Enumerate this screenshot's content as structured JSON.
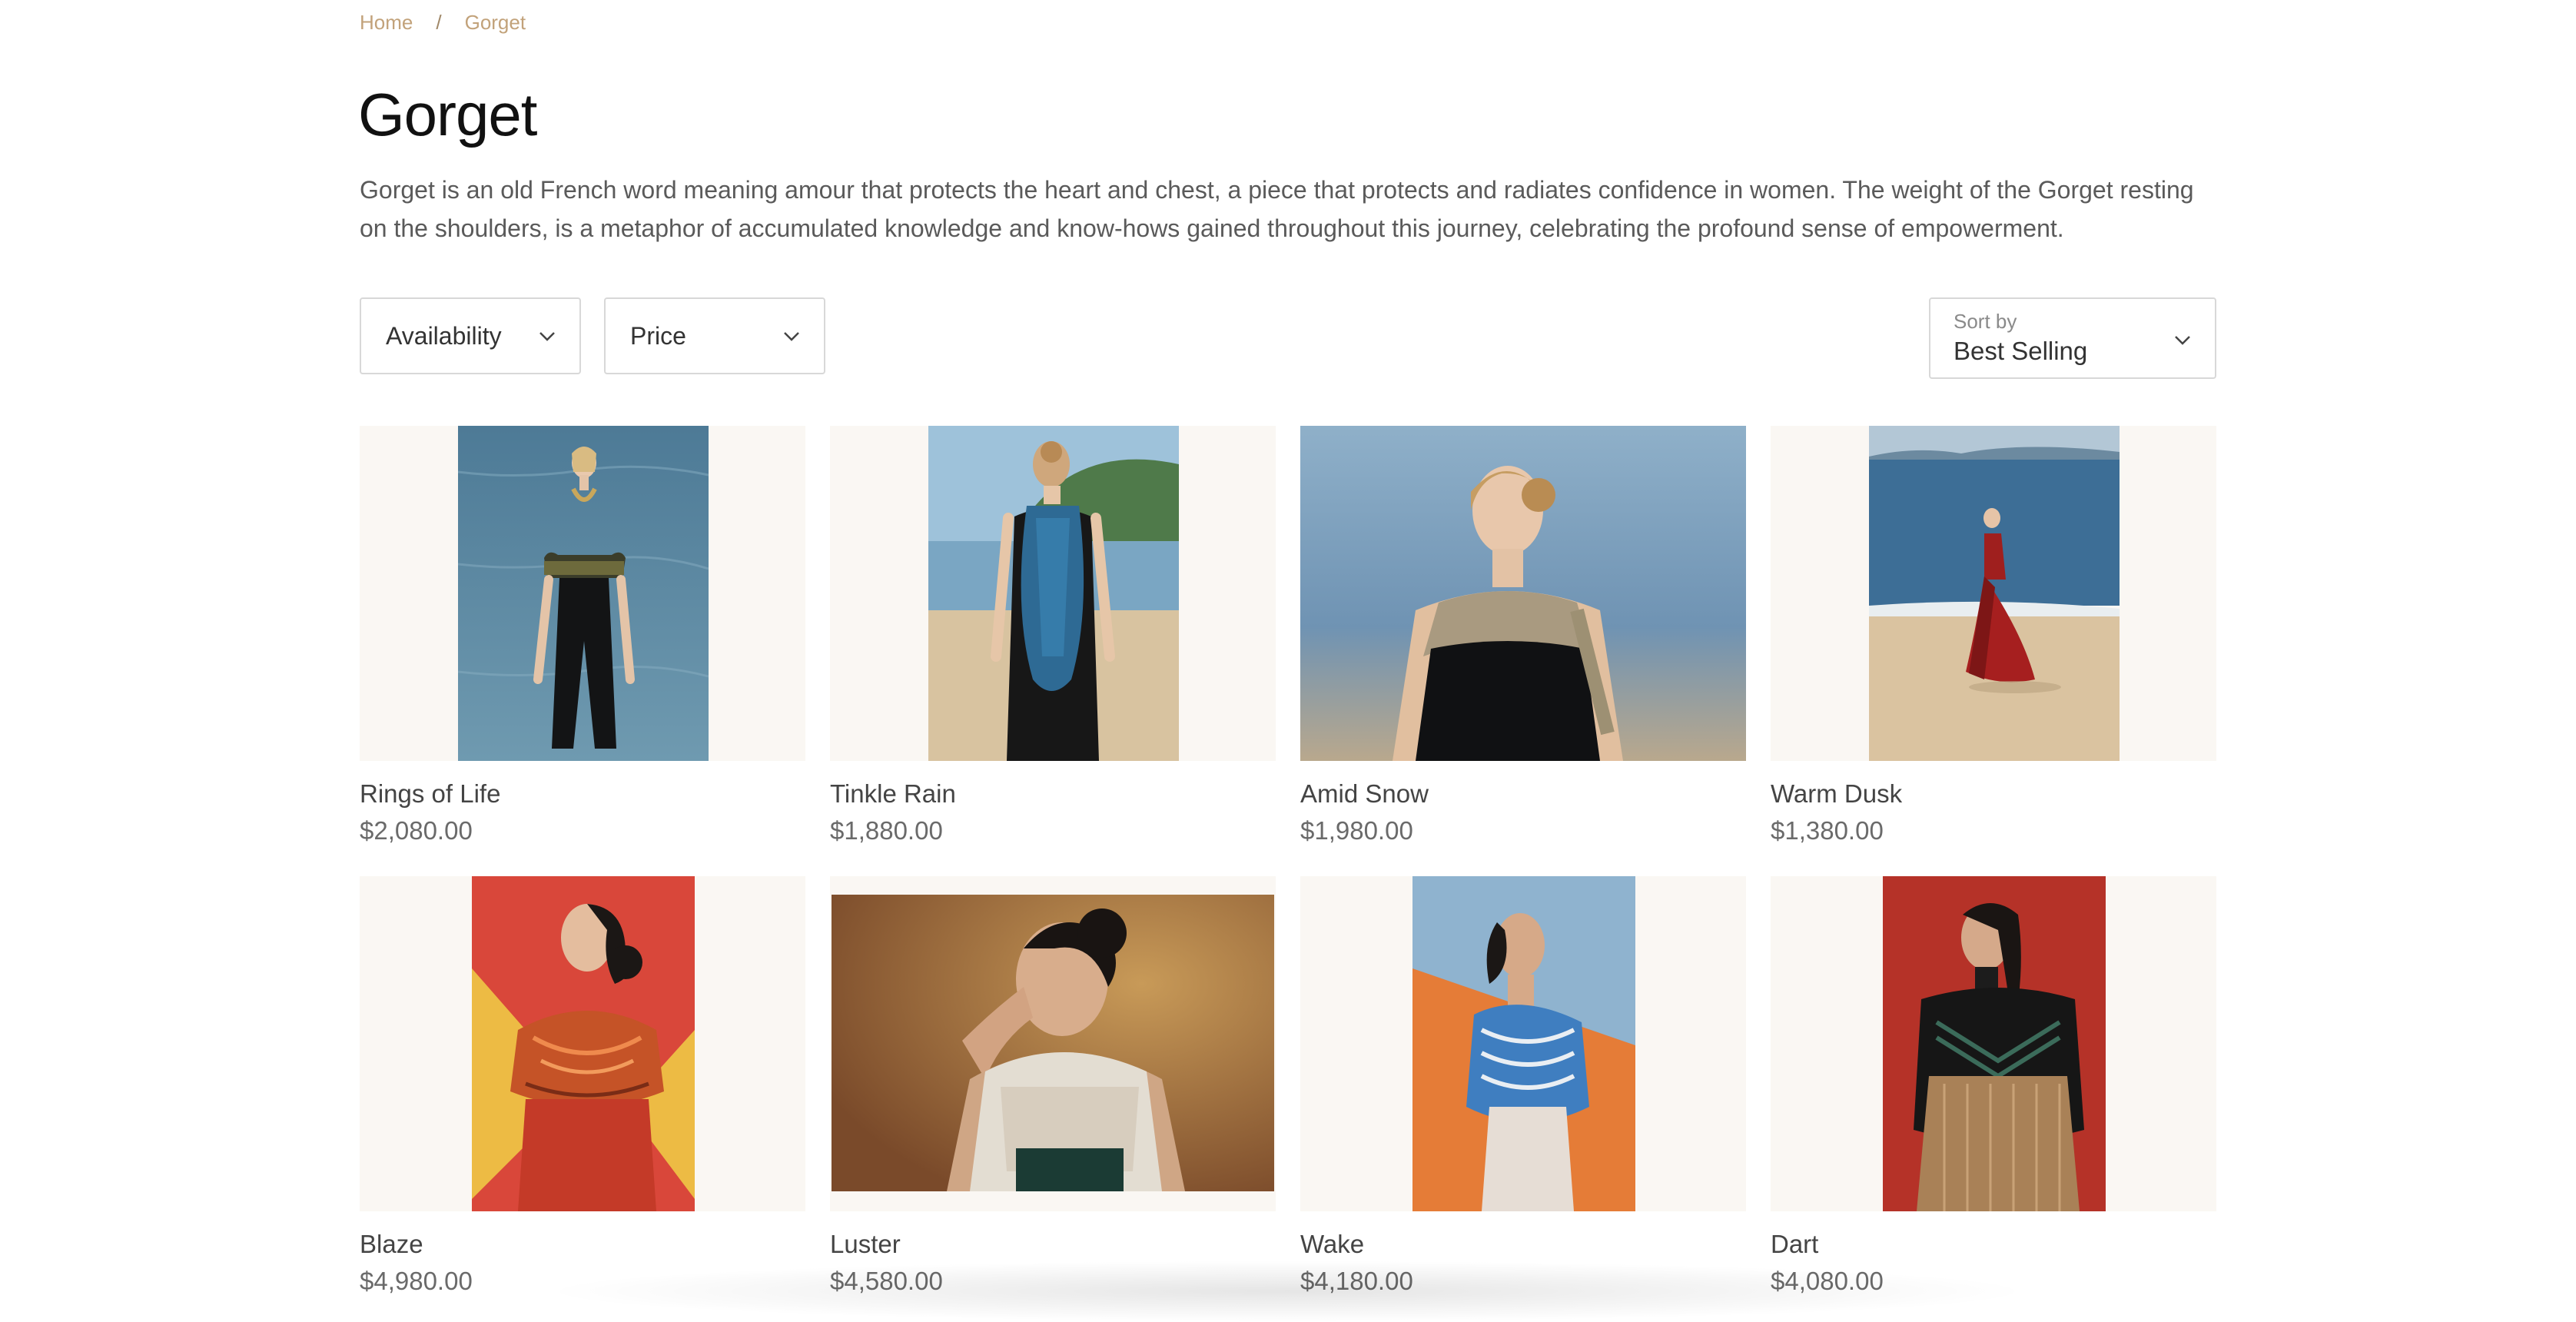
{
  "breadcrumb": {
    "home": "Home",
    "separator": "/",
    "current": "Gorget"
  },
  "page": {
    "title": "Gorget",
    "description": "Gorget is an old French word meaning amour that protects the heart and chest, a piece that protects and radiates confidence in women. The weight of the Gorget resting on the shoulders, is a metaphor of accumulated knowledge and know-hows gained throughout this journey,  celebrating the profound sense of empowerment."
  },
  "filters": {
    "availability_label": "Availability",
    "price_label": "Price",
    "sort_label": "Sort by",
    "sort_value": "Best Selling",
    "chevron_icon": "chevron-down-icon"
  },
  "products": [
    {
      "name": "Rings of Life",
      "price": "$2,080.00"
    },
    {
      "name": "Tinkle Rain",
      "price": "$1,880.00"
    },
    {
      "name": "Amid Snow",
      "price": "$1,980.00"
    },
    {
      "name": "Warm Dusk",
      "price": "$1,380.00"
    },
    {
      "name": "Blaze",
      "price": "$4,980.00"
    },
    {
      "name": "Luster",
      "price": "$4,580.00"
    },
    {
      "name": "Wake",
      "price": "$4,180.00"
    },
    {
      "name": "Dart",
      "price": "$4,080.00"
    }
  ],
  "colors": {
    "accent": "#c2a27a",
    "card_background": "#faf7f3",
    "border": "#d8d8d8"
  }
}
